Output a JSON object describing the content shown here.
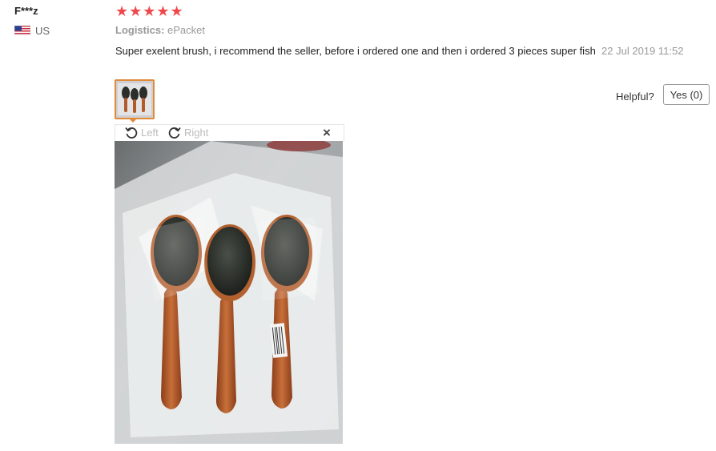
{
  "reviewer": {
    "name": "F***z",
    "country": "US"
  },
  "rating": {
    "stars": 5,
    "stars_text": "★★★★★"
  },
  "logistics": {
    "label": "Logistics:",
    "value": "ePacket"
  },
  "review": {
    "text": "Super exelent brush, i recommend the seller, before i ordered one and then i ordered 3 pieces super fish",
    "date": "22 Jul 2019 11:52"
  },
  "helpful": {
    "label": "Helpful?",
    "yes_button": "Yes (0)"
  },
  "viewer": {
    "rotate_left": "Left",
    "rotate_right": "Right",
    "close": "×"
  },
  "colors": {
    "star": "#f0474b",
    "thumb_border": "#e08a3a",
    "muted": "#999999"
  },
  "icons": [
    "us-flag-icon",
    "rotate-left-icon",
    "rotate-right-icon",
    "close-icon"
  ]
}
